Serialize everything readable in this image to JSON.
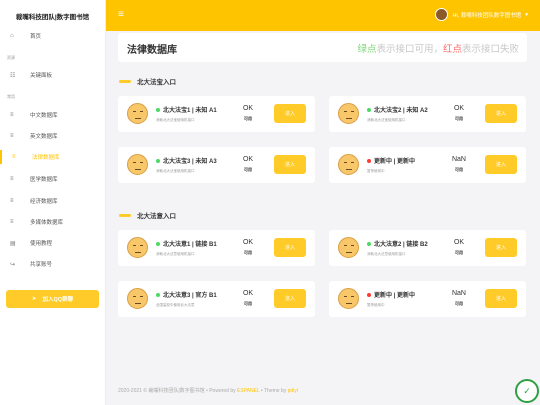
{
  "brand": "裁嘴科技团队|数字图书馆",
  "sidebar": {
    "sections": [
      "首页",
      "资源",
      "常用"
    ],
    "items": [
      {
        "label": "首页",
        "icon": "home-icon",
        "glyph": "⌂"
      },
      {
        "label": "关键面板",
        "icon": "chart-icon",
        "glyph": "☷"
      },
      {
        "label": "中文数据库",
        "icon": "list-icon",
        "glyph": "≡"
      },
      {
        "label": "英文数据库",
        "icon": "list-icon",
        "glyph": "≡"
      },
      {
        "label": "法律数据库",
        "icon": "list-icon",
        "glyph": "≡",
        "active": true
      },
      {
        "label": "医学数据库",
        "icon": "list-icon",
        "glyph": "≡"
      },
      {
        "label": "经济数据库",
        "icon": "list-icon",
        "glyph": "≡"
      },
      {
        "label": "多媒体数据库",
        "icon": "list-icon",
        "glyph": "≡"
      },
      {
        "label": "使用教程",
        "icon": "book-icon",
        "glyph": "▤"
      },
      {
        "label": "共享账号",
        "icon": "share-icon",
        "glyph": "↪"
      }
    ],
    "join_label": "加入QQ群聊",
    "join_icon": "send-icon"
  },
  "topbar": {
    "user_label": "Hi, 裁嘴科技团队数字图书馆",
    "chevron": "▾"
  },
  "header": {
    "title": "法律数据库",
    "legend_green": "绿点",
    "legend_mid1": "表示接口可用，",
    "legend_red": "红点",
    "legend_mid2": "表示接口失败"
  },
  "sections": [
    {
      "title": "北大法宝入口"
    },
    {
      "title": "北大法意入口"
    }
  ],
  "cards": [
    {
      "title": "北大法宝1 | 未知 A1",
      "desc": "消耗北大法宝使用机接口",
      "status": "OK",
      "sub": "可用",
      "ok": true,
      "btn": "进入"
    },
    {
      "title": "北大法宝2 | 未知 A2",
      "desc": "消耗北大法宝使用机接口",
      "status": "OK",
      "sub": "可用",
      "ok": true,
      "btn": "进入"
    },
    {
      "title": "北大法宝3 | 未知 A3",
      "desc": "消耗北大法宝使用机接口",
      "status": "OK",
      "sub": "可用",
      "ok": true,
      "btn": "进入"
    },
    {
      "title": "更新中 | 更新中",
      "desc": "暂停使用中",
      "status": "NaN",
      "sub": "可用",
      "ok": false,
      "btn": "进入"
    },
    {
      "title": "北大法意1 | 链接 B1",
      "desc": "消耗北大法意使用机接口",
      "status": "OK",
      "sub": "可用",
      "ok": true,
      "btn": "进入"
    },
    {
      "title": "北大法意2 | 链接 B2",
      "desc": "消耗北大法意使用机接口",
      "status": "OK",
      "sub": "可用",
      "ok": true,
      "btn": "进入"
    },
    {
      "title": "北大法意3 | 官方 B1",
      "desc": "全国高校中使用北大法意",
      "status": "OK",
      "sub": "可用",
      "ok": true,
      "btn": "进入"
    },
    {
      "title": "更新中 | 更新中",
      "desc": "暂停使用中",
      "status": "NaN",
      "sub": "可用",
      "ok": false,
      "btn": "进入"
    }
  ],
  "footer": {
    "copyright": "2020-2021 © 裁嘴科技团队|数字图书馆",
    "sep": " • ",
    "powered": "Powered by ",
    "powered_link": "ESPANEL",
    "theme": "Theme by ",
    "theme_link": "pdiyi"
  },
  "badge": "✓",
  "colors": {
    "accent": "#ffc400",
    "ok": "#4cd964",
    "fail": "#ff3b30"
  }
}
